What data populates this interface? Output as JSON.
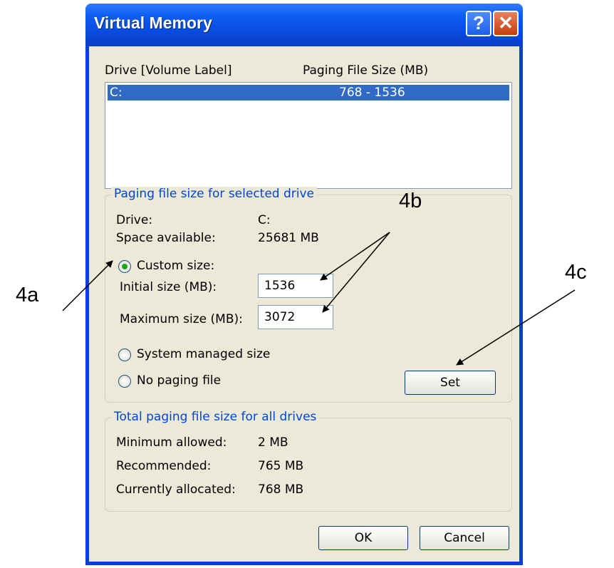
{
  "window": {
    "title": "Virtual Memory",
    "help_glyph": "?",
    "close_glyph": "✕"
  },
  "list": {
    "col_drive": "Drive  [Volume Label]",
    "col_size": "Paging File Size (MB)",
    "rows": [
      {
        "drive": "C:",
        "size": "768 - 1536"
      }
    ]
  },
  "selected": {
    "group_label": "Paging file size for selected drive",
    "drive_label": "Drive:",
    "drive_value": "C:",
    "space_label": "Space available:",
    "space_value": "25681 MB",
    "custom_label": "Custom size:",
    "initial_label": "Initial size (MB):",
    "initial_value": "1536",
    "max_label": "Maximum size (MB):",
    "max_value": "3072",
    "system_label": "System managed size",
    "nopage_label": "No paging file",
    "set_label": "Set",
    "selected_option": "custom"
  },
  "total": {
    "group_label": "Total paging file size for all drives",
    "min_label": "Minimum allowed:",
    "min_value": "2 MB",
    "rec_label": "Recommended:",
    "rec_value": "765 MB",
    "alloc_label": "Currently allocated:",
    "alloc_value": "768 MB"
  },
  "buttons": {
    "ok": "OK",
    "cancel": "Cancel"
  },
  "annotations": {
    "a": "4a",
    "b": "4b",
    "c": "4c"
  }
}
